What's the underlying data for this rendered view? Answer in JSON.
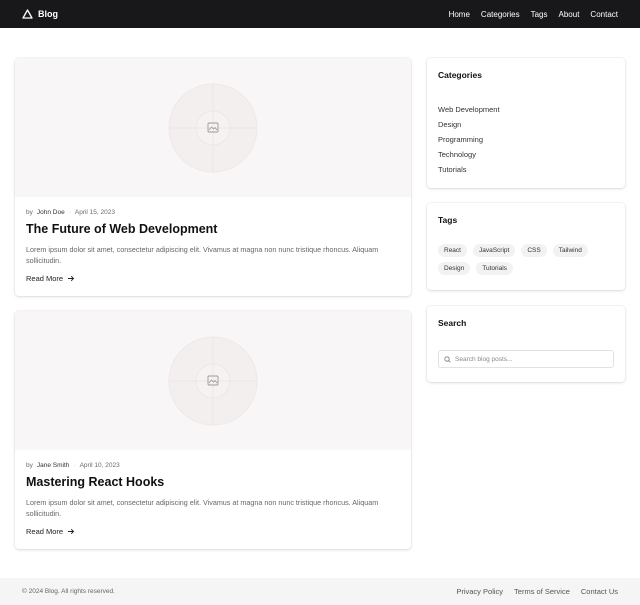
{
  "header": {
    "brand": "Blog",
    "nav": [
      "Home",
      "Categories",
      "Tags",
      "About",
      "Contact"
    ]
  },
  "posts": [
    {
      "by": "by",
      "author": "John Doe",
      "date": "April 15, 2023",
      "title": "The Future of Web Development",
      "excerpt": "Lorem ipsum dolor sit amet, consectetur adipiscing elit. Vivamus at magna non nunc tristique rhoncus. Aliquam sollicitudin.",
      "read_more": "Read More"
    },
    {
      "by": "by",
      "author": "Jane Smith",
      "date": "April 10, 2023",
      "title": "Mastering React Hooks",
      "excerpt": "Lorem ipsum dolor sit amet, consectetur adipiscing elit. Vivamus at magna non nunc tristique rhoncus. Aliquam sollicitudin.",
      "read_more": "Read More"
    }
  ],
  "sidebar": {
    "categories": {
      "title": "Categories",
      "items": [
        "Web Development",
        "Design",
        "Programming",
        "Technology",
        "Tutorials"
      ]
    },
    "tags": {
      "title": "Tags",
      "items": [
        "React",
        "JavaScript",
        "CSS",
        "Tailwind",
        "Design",
        "Tutorials"
      ]
    },
    "search": {
      "title": "Search",
      "placeholder": "Search blog posts..."
    }
  },
  "footer": {
    "copyright": "© 2024 Blog. All rights reserved.",
    "links": [
      "Privacy Policy",
      "Terms of Service",
      "Contact Us"
    ]
  },
  "icons": {
    "brand": "triangle-logo-icon",
    "thumb": "image-placeholder-icon",
    "read_more": "arrow-right-icon",
    "search": "search-icon"
  }
}
